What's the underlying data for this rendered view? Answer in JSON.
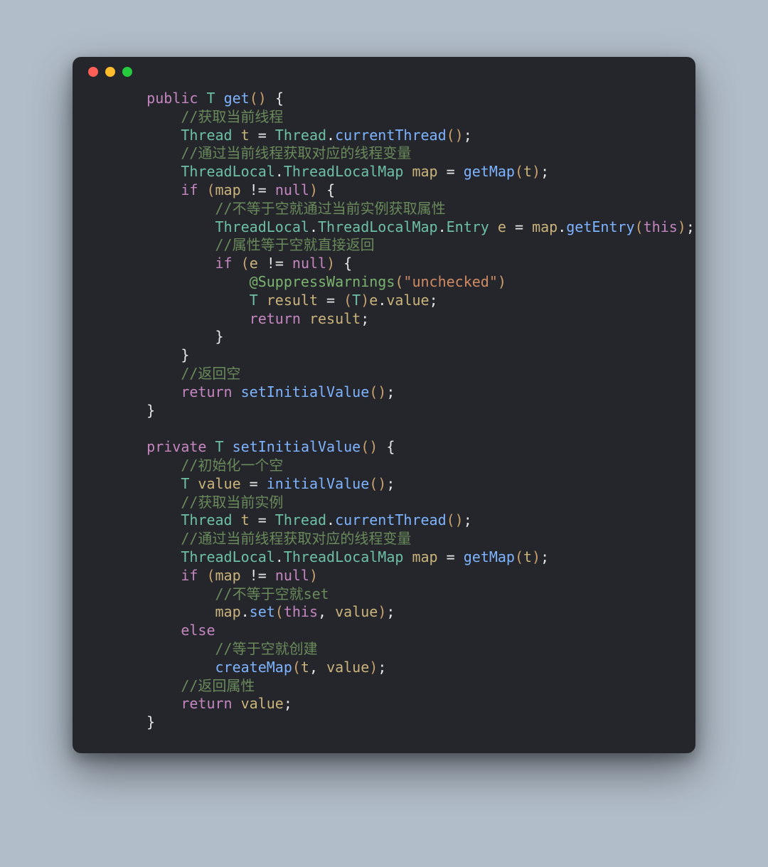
{
  "colors": {
    "background": "#b1bdc9",
    "window_bg": "#24262b",
    "text": "#d5d9e0",
    "keyword": "#c586c0",
    "type": "#6dc0a4",
    "function": "#7eb3ff",
    "variable": "#cbb47b",
    "paren": "#c9a26d",
    "comment": "#6a8a5b",
    "string": "#d08a63",
    "annotation": "#7bb36f",
    "dot_red": "#ff5f56",
    "dot_yellow": "#ffbd2e",
    "dot_green": "#27c93f"
  },
  "code_text": "    public T get() {\n        //获取当前线程\n        Thread t = Thread.currentThread();\n        //通过当前线程获取对应的线程变量\n        ThreadLocal.ThreadLocalMap map = getMap(t);\n        if (map != null) {\n            //不等于空就通过当前实例获取属性\n            ThreadLocal.ThreadLocalMap.Entry e = map.getEntry(this);\n            //属性等于空就直接返回\n            if (e != null) {\n                @SuppressWarnings(\"unchecked\")\n                T result = (T)e.value;\n                return result;\n            }\n        }\n        //返回空\n        return setInitialValue();\n    }\n\n    private T setInitialValue() {\n        //初始化一个空\n        T value = initialValue();\n        //获取当前实例\n        Thread t = Thread.currentThread();\n        //通过当前线程获取对应的线程变量\n        ThreadLocal.ThreadLocalMap map = getMap(t);\n        if (map != null)\n            //不等于空就set\n            map.set(this, value);\n        else\n            //等于空就创建\n            createMap(t, value);\n        //返回属性\n        return value;\n    }",
  "tokens": [
    {
      "type": "line",
      "indent": 4,
      "parts": [
        {
          "c": "kw",
          "t": "public"
        },
        {
          "c": "op",
          "t": " "
        },
        {
          "c": "ty",
          "t": "T"
        },
        {
          "c": "op",
          "t": " "
        },
        {
          "c": "fn",
          "t": "get"
        },
        {
          "c": "pn",
          "t": "()"
        },
        {
          "c": "op",
          "t": " {"
        }
      ]
    },
    {
      "type": "line",
      "indent": 8,
      "parts": [
        {
          "c": "cm",
          "t": "//获取当前线程"
        }
      ]
    },
    {
      "type": "line",
      "indent": 8,
      "parts": [
        {
          "c": "ty",
          "t": "Thread"
        },
        {
          "c": "op",
          "t": " "
        },
        {
          "c": "va",
          "t": "t"
        },
        {
          "c": "op",
          "t": " = "
        },
        {
          "c": "ty",
          "t": "Thread"
        },
        {
          "c": "op",
          "t": "."
        },
        {
          "c": "fn",
          "t": "currentThread"
        },
        {
          "c": "pn",
          "t": "()"
        },
        {
          "c": "op",
          "t": ";"
        }
      ]
    },
    {
      "type": "line",
      "indent": 8,
      "parts": [
        {
          "c": "cm",
          "t": "//通过当前线程获取对应的线程变量"
        }
      ]
    },
    {
      "type": "line",
      "indent": 8,
      "parts": [
        {
          "c": "ty",
          "t": "ThreadLocal"
        },
        {
          "c": "op",
          "t": "."
        },
        {
          "c": "ty",
          "t": "ThreadLocalMap"
        },
        {
          "c": "op",
          "t": " "
        },
        {
          "c": "va",
          "t": "map"
        },
        {
          "c": "op",
          "t": " = "
        },
        {
          "c": "fn",
          "t": "getMap"
        },
        {
          "c": "pn",
          "t": "("
        },
        {
          "c": "va",
          "t": "t"
        },
        {
          "c": "pn",
          "t": ")"
        },
        {
          "c": "op",
          "t": ";"
        }
      ]
    },
    {
      "type": "line",
      "indent": 8,
      "parts": [
        {
          "c": "kw",
          "t": "if"
        },
        {
          "c": "op",
          "t": " "
        },
        {
          "c": "pn",
          "t": "("
        },
        {
          "c": "va",
          "t": "map"
        },
        {
          "c": "op",
          "t": " != "
        },
        {
          "c": "kw",
          "t": "null"
        },
        {
          "c": "pn",
          "t": ")"
        },
        {
          "c": "op",
          "t": " {"
        }
      ]
    },
    {
      "type": "line",
      "indent": 12,
      "parts": [
        {
          "c": "cm",
          "t": "//不等于空就通过当前实例获取属性"
        }
      ]
    },
    {
      "type": "line",
      "indent": 12,
      "parts": [
        {
          "c": "ty",
          "t": "ThreadLocal"
        },
        {
          "c": "op",
          "t": "."
        },
        {
          "c": "ty",
          "t": "ThreadLocalMap"
        },
        {
          "c": "op",
          "t": "."
        },
        {
          "c": "ty",
          "t": "Entry"
        },
        {
          "c": "op",
          "t": " "
        },
        {
          "c": "va",
          "t": "e"
        },
        {
          "c": "op",
          "t": " = "
        },
        {
          "c": "va",
          "t": "map"
        },
        {
          "c": "op",
          "t": "."
        },
        {
          "c": "fn",
          "t": "getEntry"
        },
        {
          "c": "pn",
          "t": "("
        },
        {
          "c": "kw",
          "t": "this"
        },
        {
          "c": "pn",
          "t": ")"
        },
        {
          "c": "op",
          "t": ";"
        }
      ]
    },
    {
      "type": "line",
      "indent": 12,
      "parts": [
        {
          "c": "cm",
          "t": "//属性等于空就直接返回"
        }
      ]
    },
    {
      "type": "line",
      "indent": 12,
      "parts": [
        {
          "c": "kw",
          "t": "if"
        },
        {
          "c": "op",
          "t": " "
        },
        {
          "c": "pn",
          "t": "("
        },
        {
          "c": "va",
          "t": "e"
        },
        {
          "c": "op",
          "t": " != "
        },
        {
          "c": "kw",
          "t": "null"
        },
        {
          "c": "pn",
          "t": ")"
        },
        {
          "c": "op",
          "t": " {"
        }
      ]
    },
    {
      "type": "line",
      "indent": 16,
      "parts": [
        {
          "c": "an",
          "t": "@SuppressWarnings"
        },
        {
          "c": "pn",
          "t": "("
        },
        {
          "c": "st",
          "t": "\"unchecked\""
        },
        {
          "c": "pn",
          "t": ")"
        }
      ]
    },
    {
      "type": "line",
      "indent": 16,
      "parts": [
        {
          "c": "ty",
          "t": "T"
        },
        {
          "c": "op",
          "t": " "
        },
        {
          "c": "va",
          "t": "result"
        },
        {
          "c": "op",
          "t": " = "
        },
        {
          "c": "pn",
          "t": "("
        },
        {
          "c": "ty",
          "t": "T"
        },
        {
          "c": "pn",
          "t": ")"
        },
        {
          "c": "va",
          "t": "e"
        },
        {
          "c": "op",
          "t": "."
        },
        {
          "c": "va",
          "t": "value"
        },
        {
          "c": "op",
          "t": ";"
        }
      ]
    },
    {
      "type": "line",
      "indent": 16,
      "parts": [
        {
          "c": "kw",
          "t": "return"
        },
        {
          "c": "op",
          "t": " "
        },
        {
          "c": "va",
          "t": "result"
        },
        {
          "c": "op",
          "t": ";"
        }
      ]
    },
    {
      "type": "line",
      "indent": 12,
      "parts": [
        {
          "c": "op",
          "t": "}"
        }
      ]
    },
    {
      "type": "line",
      "indent": 8,
      "parts": [
        {
          "c": "op",
          "t": "}"
        }
      ]
    },
    {
      "type": "line",
      "indent": 8,
      "parts": [
        {
          "c": "cm",
          "t": "//返回空"
        }
      ]
    },
    {
      "type": "line",
      "indent": 8,
      "parts": [
        {
          "c": "kw",
          "t": "return"
        },
        {
          "c": "op",
          "t": " "
        },
        {
          "c": "fn",
          "t": "setInitialValue"
        },
        {
          "c": "pn",
          "t": "()"
        },
        {
          "c": "op",
          "t": ";"
        }
      ]
    },
    {
      "type": "line",
      "indent": 4,
      "parts": [
        {
          "c": "op",
          "t": "}"
        }
      ]
    },
    {
      "type": "blank"
    },
    {
      "type": "line",
      "indent": 4,
      "parts": [
        {
          "c": "kw",
          "t": "private"
        },
        {
          "c": "op",
          "t": " "
        },
        {
          "c": "ty",
          "t": "T"
        },
        {
          "c": "op",
          "t": " "
        },
        {
          "c": "fn",
          "t": "setInitialValue"
        },
        {
          "c": "pn",
          "t": "()"
        },
        {
          "c": "op",
          "t": " {"
        }
      ]
    },
    {
      "type": "line",
      "indent": 8,
      "parts": [
        {
          "c": "cm",
          "t": "//初始化一个空"
        }
      ]
    },
    {
      "type": "line",
      "indent": 8,
      "parts": [
        {
          "c": "ty",
          "t": "T"
        },
        {
          "c": "op",
          "t": " "
        },
        {
          "c": "va",
          "t": "value"
        },
        {
          "c": "op",
          "t": " = "
        },
        {
          "c": "fn",
          "t": "initialValue"
        },
        {
          "c": "pn",
          "t": "()"
        },
        {
          "c": "op",
          "t": ";"
        }
      ]
    },
    {
      "type": "line",
      "indent": 8,
      "parts": [
        {
          "c": "cm",
          "t": "//获取当前实例"
        }
      ]
    },
    {
      "type": "line",
      "indent": 8,
      "parts": [
        {
          "c": "ty",
          "t": "Thread"
        },
        {
          "c": "op",
          "t": " "
        },
        {
          "c": "va",
          "t": "t"
        },
        {
          "c": "op",
          "t": " = "
        },
        {
          "c": "ty",
          "t": "Thread"
        },
        {
          "c": "op",
          "t": "."
        },
        {
          "c": "fn",
          "t": "currentThread"
        },
        {
          "c": "pn",
          "t": "()"
        },
        {
          "c": "op",
          "t": ";"
        }
      ]
    },
    {
      "type": "line",
      "indent": 8,
      "parts": [
        {
          "c": "cm",
          "t": "//通过当前线程获取对应的线程变量"
        }
      ]
    },
    {
      "type": "line",
      "indent": 8,
      "parts": [
        {
          "c": "ty",
          "t": "ThreadLocal"
        },
        {
          "c": "op",
          "t": "."
        },
        {
          "c": "ty",
          "t": "ThreadLocalMap"
        },
        {
          "c": "op",
          "t": " "
        },
        {
          "c": "va",
          "t": "map"
        },
        {
          "c": "op",
          "t": " = "
        },
        {
          "c": "fn",
          "t": "getMap"
        },
        {
          "c": "pn",
          "t": "("
        },
        {
          "c": "va",
          "t": "t"
        },
        {
          "c": "pn",
          "t": ")"
        },
        {
          "c": "op",
          "t": ";"
        }
      ]
    },
    {
      "type": "line",
      "indent": 8,
      "parts": [
        {
          "c": "kw",
          "t": "if"
        },
        {
          "c": "op",
          "t": " "
        },
        {
          "c": "pn",
          "t": "("
        },
        {
          "c": "va",
          "t": "map"
        },
        {
          "c": "op",
          "t": " != "
        },
        {
          "c": "kw",
          "t": "null"
        },
        {
          "c": "pn",
          "t": ")"
        }
      ]
    },
    {
      "type": "line",
      "indent": 12,
      "parts": [
        {
          "c": "cm",
          "t": "//不等于空就set"
        }
      ]
    },
    {
      "type": "line",
      "indent": 12,
      "parts": [
        {
          "c": "va",
          "t": "map"
        },
        {
          "c": "op",
          "t": "."
        },
        {
          "c": "fn",
          "t": "set"
        },
        {
          "c": "pn",
          "t": "("
        },
        {
          "c": "kw",
          "t": "this"
        },
        {
          "c": "op",
          "t": ", "
        },
        {
          "c": "va",
          "t": "value"
        },
        {
          "c": "pn",
          "t": ")"
        },
        {
          "c": "op",
          "t": ";"
        }
      ]
    },
    {
      "type": "line",
      "indent": 8,
      "parts": [
        {
          "c": "kw",
          "t": "else"
        }
      ]
    },
    {
      "type": "line",
      "indent": 12,
      "parts": [
        {
          "c": "cm",
          "t": "//等于空就创建"
        }
      ]
    },
    {
      "type": "line",
      "indent": 12,
      "parts": [
        {
          "c": "fn",
          "t": "createMap"
        },
        {
          "c": "pn",
          "t": "("
        },
        {
          "c": "va",
          "t": "t"
        },
        {
          "c": "op",
          "t": ", "
        },
        {
          "c": "va",
          "t": "value"
        },
        {
          "c": "pn",
          "t": ")"
        },
        {
          "c": "op",
          "t": ";"
        }
      ]
    },
    {
      "type": "line",
      "indent": 8,
      "parts": [
        {
          "c": "cm",
          "t": "//返回属性"
        }
      ]
    },
    {
      "type": "line",
      "indent": 8,
      "parts": [
        {
          "c": "kw",
          "t": "return"
        },
        {
          "c": "op",
          "t": " "
        },
        {
          "c": "va",
          "t": "value"
        },
        {
          "c": "op",
          "t": ";"
        }
      ]
    },
    {
      "type": "line",
      "indent": 4,
      "parts": [
        {
          "c": "op",
          "t": "}"
        }
      ]
    }
  ]
}
